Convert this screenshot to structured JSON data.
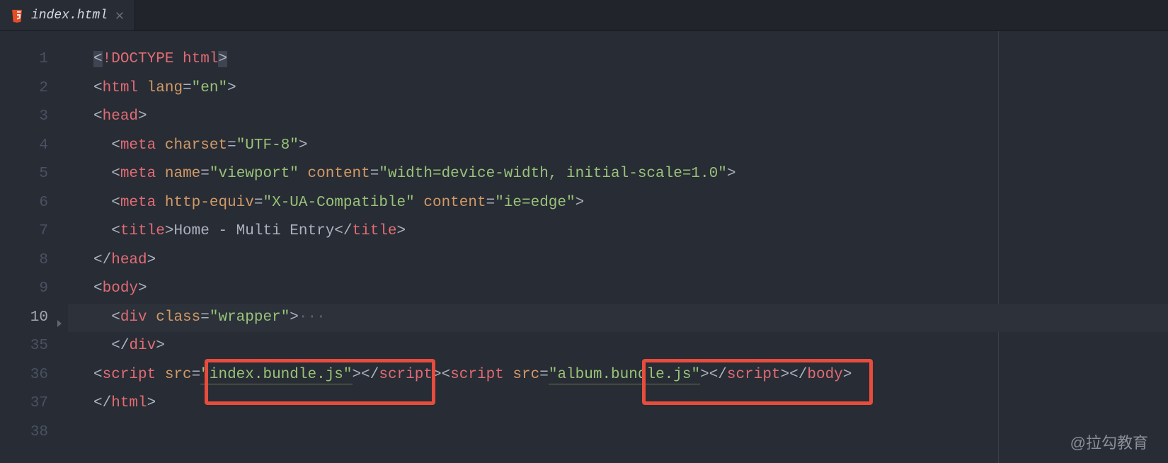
{
  "tab": {
    "filename": "index.html",
    "icon_name": "html5-icon",
    "icon_color": "#e44d26"
  },
  "gutter": {
    "line_numbers": [
      "1",
      "2",
      "3",
      "4",
      "5",
      "6",
      "7",
      "8",
      "9",
      "10",
      "35",
      "36",
      "37",
      "38"
    ],
    "current_index": 9,
    "folded_at_index": 9
  },
  "code": {
    "l1": {
      "ob": "<",
      "doctype": "!DOCTYPE html",
      "cb": ">"
    },
    "l2": {
      "ob": "<",
      "tag": "html",
      "sp": " ",
      "attr": "lang",
      "eq": "=",
      "str": "\"en\"",
      "cb": ">"
    },
    "l3": {
      "ob": "<",
      "tag": "head",
      "cb": ">"
    },
    "l4": {
      "indent": "  ",
      "ob": "<",
      "tag": "meta",
      "sp": " ",
      "attr": "charset",
      "eq": "=",
      "str": "\"UTF-8\"",
      "cb": ">"
    },
    "l5": {
      "indent": "  ",
      "ob": "<",
      "tag": "meta",
      "sp": " ",
      "attr1": "name",
      "eq1": "=",
      "str1": "\"viewport\"",
      "sp2": " ",
      "attr2": "content",
      "eq2": "=",
      "str2": "\"width=device-width, initial-scale=1.0\"",
      "cb": ">"
    },
    "l6": {
      "indent": "  ",
      "ob": "<",
      "tag": "meta",
      "sp": " ",
      "attr1": "http-equiv",
      "eq1": "=",
      "str1": "\"X-UA-Compatible\"",
      "sp2": " ",
      "attr2": "content",
      "eq2": "=",
      "str2": "\"ie=edge\"",
      "cb": ">"
    },
    "l7": {
      "indent": "  ",
      "ob": "<",
      "tag": "title",
      "cb": ">",
      "text": "Home - Multi Entry",
      "ob2": "</",
      "tag2": "title",
      "cb2": ">"
    },
    "l8": {
      "ob": "</",
      "tag": "head",
      "cb": ">"
    },
    "l9": {
      "ob": "<",
      "tag": "body",
      "cb": ">"
    },
    "l10": {
      "indent": "  ",
      "ob": "<",
      "tag": "div",
      "sp": " ",
      "attr": "class",
      "eq": "=",
      "str": "\"wrapper\"",
      "cb": ">",
      "fold": "···"
    },
    "l35": {
      "indent": "  ",
      "ob": "</",
      "tag": "div",
      "cb": ">"
    },
    "l36": {
      "s1_ob": "<",
      "s1_tag": "script",
      "s1_sp": " ",
      "s1_attr": "src",
      "s1_eq": "=",
      "s1_str": "\"index.bundle.js\"",
      "s1_cb": ">",
      "s1c_ob": "</",
      "s1c_tag": "script",
      "s1c_cb": ">",
      "s2_ob": "<",
      "s2_tag": "script",
      "s2_sp": " ",
      "s2_attr": "src",
      "s2_eq": "=",
      "s2_str": "\"album.bundle.js\"",
      "s2_cb": ">",
      "s2c_ob": "</",
      "s2c_tag": "script",
      "s2c_cb": ">",
      "b_ob": "</",
      "b_tag": "body",
      "b_cb": ">"
    },
    "l37": {
      "ob": "</",
      "tag": "html",
      "cb": ">"
    }
  },
  "annotations": {
    "box1": "index.bundle.js highlight",
    "box2": "album.bundle.js highlight"
  },
  "watermark": "@拉勾教育"
}
